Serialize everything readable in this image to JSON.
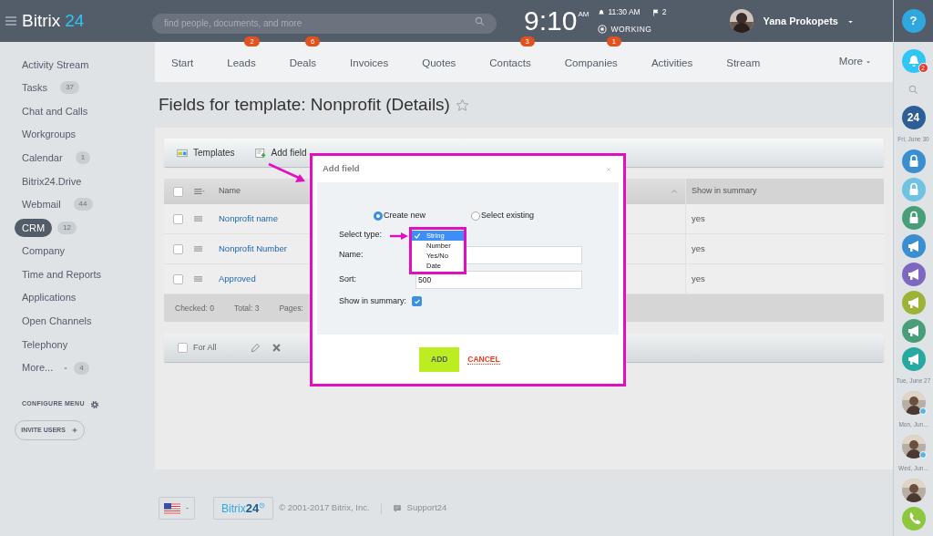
{
  "header": {
    "logo": "Bitrix",
    "logo_number": "24",
    "search": {
      "placeholder": "find people, documents, and more"
    },
    "clock": "9:10",
    "clock_suffix": "AM",
    "alarm": "11:30 AM",
    "flags": "2",
    "work_status": "WORKING",
    "user_name": "Yana Prokopets"
  },
  "sidebar": {
    "items": [
      {
        "label": "Activity Stream",
        "selected": false
      },
      {
        "label": "Tasks",
        "count": "37",
        "selected": false
      },
      {
        "label": "Chat and Calls",
        "selected": false
      },
      {
        "label": "Workgroups",
        "selected": false
      },
      {
        "label": "Calendar",
        "count": "1",
        "selected": false
      },
      {
        "label": "Bitrix24.Drive",
        "selected": false
      },
      {
        "label": "Webmail",
        "count": "44",
        "selected": false
      },
      {
        "label": "CRM",
        "count": "12",
        "selected": true
      },
      {
        "label": "Company",
        "selected": false
      },
      {
        "label": "Time and Reports",
        "selected": false
      },
      {
        "label": "Applications",
        "selected": false
      },
      {
        "label": "Open Channels",
        "selected": false
      },
      {
        "label": "Telephony",
        "selected": false
      },
      {
        "label": "More...",
        "count": "4",
        "selected": false,
        "kind": "more"
      }
    ],
    "configure": "CONFIGURE MENU",
    "invite": "INVITE USERS"
  },
  "nav": {
    "tabs": [
      {
        "label": "Start"
      },
      {
        "label": "Leads",
        "badge": "2"
      },
      {
        "label": "Deals",
        "badge": "6"
      },
      {
        "label": "Invoices"
      },
      {
        "label": "Quotes"
      },
      {
        "label": "Contacts",
        "badge": "3"
      },
      {
        "label": "Companies",
        "badge": "1"
      },
      {
        "label": "Activities"
      },
      {
        "label": "Stream"
      }
    ],
    "more": "More"
  },
  "page_title": "Fields for template: Nonprofit (Details)",
  "toolbar": [
    "Templates",
    "Add field"
  ],
  "table": {
    "columns": [
      "Name",
      "Show in summary"
    ],
    "header_checked": false,
    "rows": [
      {
        "name": "Nonprofit name",
        "show_in_summary": "yes",
        "checked": false
      },
      {
        "name": "Nonprofit Number",
        "show_in_summary": "yes",
        "checked": false
      },
      {
        "name": "Approved",
        "show_in_summary": "yes",
        "checked": false
      }
    ],
    "footer": [
      "Checked: 0",
      "Total: 3",
      "Pages:"
    ],
    "actions": {
      "label": "For All",
      "checked": false
    }
  },
  "dialog": {
    "title": "Add field",
    "modes": [
      {
        "label": "Create new",
        "selected": true
      },
      {
        "label": "Select existing",
        "selected": false
      }
    ],
    "type_label": "Select type:",
    "type_options": [
      {
        "label": "String",
        "selected": true
      },
      {
        "label": "Number",
        "selected": false
      },
      {
        "label": "Yes/No",
        "selected": false
      },
      {
        "label": "Date",
        "selected": false
      }
    ],
    "name_label": "Name:",
    "sort_label": "Sort:",
    "sort_value": "500",
    "summary_label": "Show in summary:",
    "summary_checked": true,
    "add": "ADD",
    "cancel": "CANCEL"
  },
  "footer": {
    "logo": "Bitrix",
    "logo_number": "24",
    "copyright": "© 2001-2017 Bitrix, Inc.",
    "support": "Support24"
  },
  "rail": [
    {
      "kind": "help",
      "label": "?"
    },
    {
      "kind": "bell",
      "badge": "2"
    },
    {
      "kind": "search"
    },
    {
      "kind": "logo",
      "label": "24"
    },
    {
      "kind": "date",
      "label": "Fri, June 30"
    },
    {
      "kind": "lock",
      "color": "#3b8ecf"
    },
    {
      "kind": "lock",
      "color": "#6fc2e0"
    },
    {
      "kind": "lock",
      "color": "#479e78"
    },
    {
      "kind": "megaphone",
      "color": "#3b8ecf"
    },
    {
      "kind": "megaphone",
      "color": "#7e67c1"
    },
    {
      "kind": "megaphone",
      "color": "#9cb335"
    },
    {
      "kind": "megaphone",
      "color": "#479e78"
    },
    {
      "kind": "megaphone",
      "color": "#26aaa0"
    },
    {
      "kind": "date",
      "label": "Tue, June 27"
    },
    {
      "kind": "avatar",
      "online": true
    },
    {
      "kind": "date",
      "label": "Mon, Jun..."
    },
    {
      "kind": "avatar",
      "online": true
    },
    {
      "kind": "date",
      "label": "Wed, Jun..."
    },
    {
      "kind": "avatar",
      "online": false
    },
    {
      "kind": "phone"
    }
  ]
}
